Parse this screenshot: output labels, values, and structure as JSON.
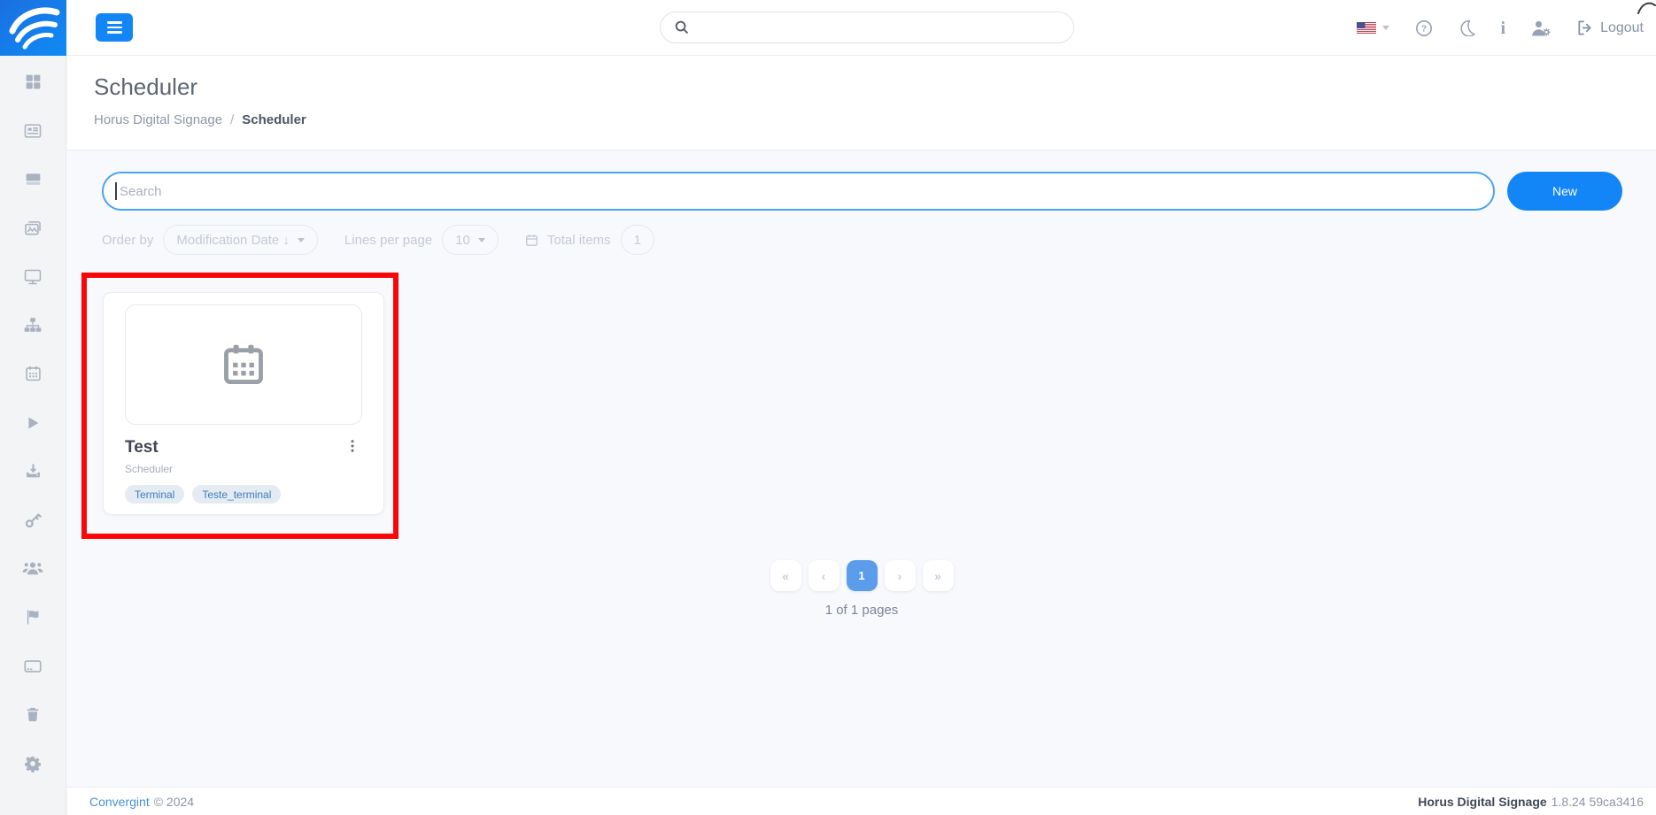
{
  "header": {
    "global_search_placeholder": "",
    "nav": {
      "language": "us-flag",
      "logout_label": "Logout",
      "help_glyph": "?",
      "info_glyph": "i"
    }
  },
  "sidebar": {
    "icons": [
      "grid",
      "newspaper",
      "panel",
      "images",
      "monitor",
      "sitemap",
      "calendar",
      "play",
      "download",
      "key",
      "users",
      "flag",
      "terminal-card",
      "trash",
      "gear"
    ]
  },
  "page": {
    "title": "Scheduler",
    "breadcrumb": {
      "parent": "Horus Digital Signage",
      "separator": "/",
      "current": "Scheduler"
    }
  },
  "toolbar": {
    "search_placeholder": "Search",
    "new_button_label": "New"
  },
  "filters": {
    "order_by_label": "Order by",
    "order_by_value": "Modification Date ↓",
    "lines_per_page_label": "Lines per page",
    "lines_per_page_value": "10",
    "total_items_label": "Total items",
    "total_items_value": "1"
  },
  "cards": [
    {
      "title": "Test",
      "subtitle": "Scheduler",
      "tags": [
        "Terminal",
        "Teste_terminal"
      ]
    }
  ],
  "pagination": {
    "first": "«",
    "prev": "‹",
    "current_page": "1",
    "next": "›",
    "last": "»",
    "summary": "1 of 1 pages"
  },
  "footer": {
    "company_link": "Convergint",
    "copyright": "© 2024",
    "product_name": "Horus Digital Signage",
    "version": "1.8.24 59ca3416"
  },
  "colors": {
    "accent_blue": "#1285f7",
    "active_page_blue": "#5b9dea",
    "annotation_red": "#fb0606",
    "tag_bg": "#e4ebf3",
    "tag_text": "#3c7cba",
    "content_bg": "#f8f9fd"
  }
}
